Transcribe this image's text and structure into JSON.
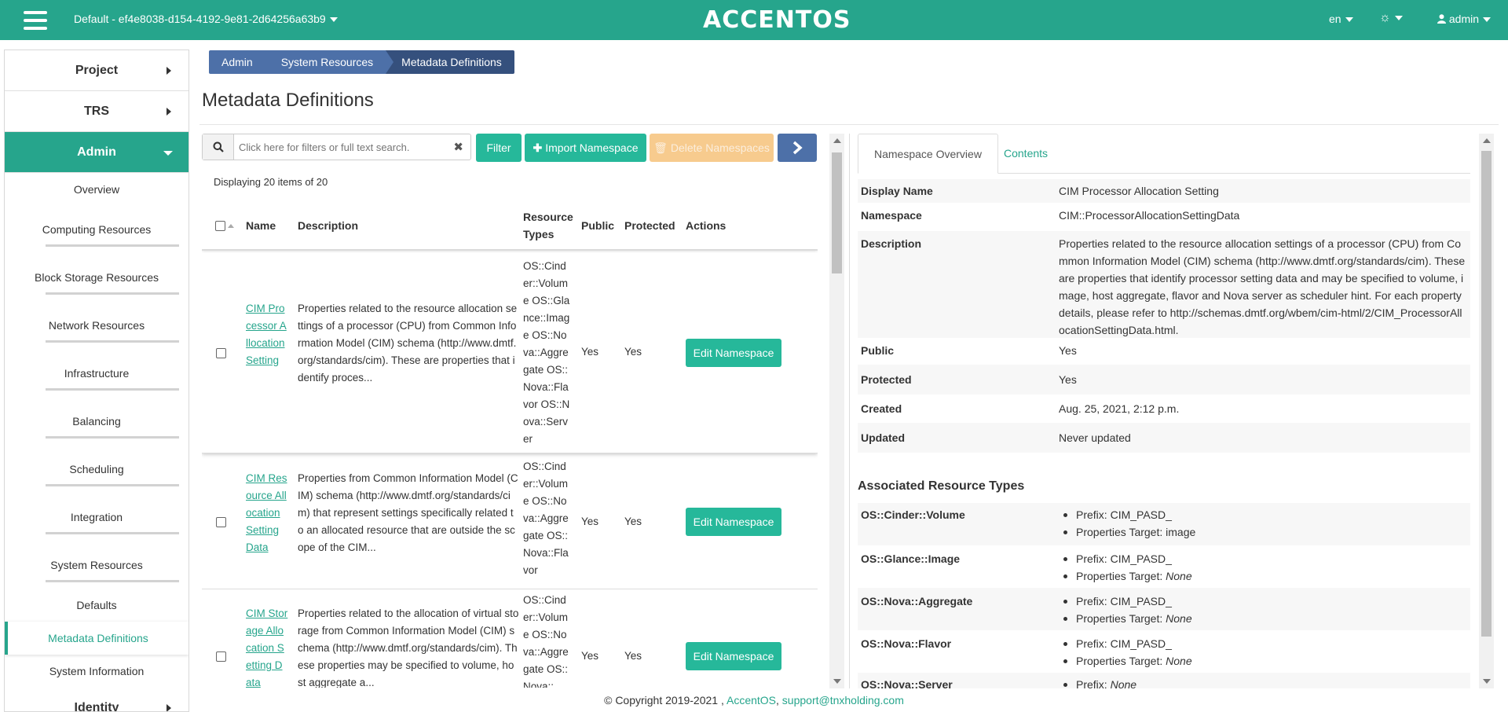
{
  "header": {
    "project_label": "Default - ef4e8038-d154-4192-9e81-2d64256a63b9",
    "logo": "ACCENTOS",
    "language": "en",
    "user": "admin",
    "brand_color": "#26a58c",
    "icons": {
      "menu": "hamburger-icon",
      "theme": "gear-icon",
      "user": "user-icon"
    }
  },
  "sidebar": {
    "sections": [
      "Project",
      "TRS",
      "Admin",
      "Identity"
    ],
    "admin_items": [
      "Overview",
      "Computing Resources",
      "Block Storage Resources",
      "Network Resources",
      "Infrastructure",
      "Balancing",
      "Scheduling",
      "Integration",
      "System Resources"
    ],
    "system_items": [
      "Defaults",
      "Metadata Definitions",
      "System Information"
    ]
  },
  "breadcrumb": [
    "Admin",
    "System Resources",
    "Metadata Definitions"
  ],
  "page_title": "Metadata Definitions",
  "toolbar": {
    "search_placeholder": "Click here for filters or full text search.",
    "filter": "Filter",
    "import": "Import Namespace",
    "delete": "Delete Namespaces"
  },
  "count_text": "Displaying 20 items of 20",
  "table": {
    "headers": {
      "name": "Name",
      "description": "Description",
      "resource_types": "Resource Types",
      "public": "Public",
      "protected": "Protected",
      "actions": "Actions"
    },
    "edit_label": "Edit Namespace",
    "rows": [
      {
        "name": "CIM Processor Allocation Setting",
        "description": "Properties related to the resource allocation settings of a processor (CPU) from Common Information Model (CIM) schema (http://www.dmtf.org/standards/cim). These are properties that identify proces...",
        "resource_types": "OS::Cinder::Volume OS::Glance::Image OS::Nova::Aggregate OS::Nova::Flavor OS::Nova::Server",
        "public": "Yes",
        "protected": "Yes"
      },
      {
        "name": "CIM Resource Allocation Setting Data",
        "description": "Properties from Common Information Model (CIM) schema (http://www.dmtf.org/standards/cim) that represent settings specifically related to an allocated resource that are outside the scope of the CIM...",
        "resource_types": "OS::Cinder::Volume OS::Nova::Aggregate OS::Nova::Flavor",
        "public": "Yes",
        "protected": "Yes"
      },
      {
        "name": "CIM Storage Allocation Setting Data",
        "description": "Properties related to the allocation of virtual storage from Common Information Model (CIM) schema (http://www.dmtf.org/standards/cim). These properties may be specified to volume, host aggregate a...",
        "resource_types": "OS::Cinder::Volume OS::Nova::Aggregate OS::Nova::",
        "public": "Yes",
        "protected": "Yes"
      }
    ]
  },
  "detail": {
    "tabs": [
      "Namespace Overview",
      "Contents"
    ],
    "fields": [
      {
        "label": "Display Name",
        "value": "CIM Processor Allocation Setting"
      },
      {
        "label": "Namespace",
        "value": "CIM::ProcessorAllocationSettingData"
      },
      {
        "label": "Description",
        "value": "Properties related to the resource allocation settings of a processor (CPU) from Common Information Model (CIM) schema (http://www.dmtf.org/standards/cim). These are properties that identify processor setting data and may be specified to volume, image, host aggregate, flavor and Nova server as scheduler hint. For each property details, please refer to http://schemas.dmtf.org/wbem/cim-html/2/CIM_ProcessorAllocationSettingData.html."
      },
      {
        "label": "Public",
        "value": "Yes"
      },
      {
        "label": "Protected",
        "value": "Yes"
      },
      {
        "label": "Created",
        "value": "Aug. 25, 2021, 2:12 p.m."
      },
      {
        "label": "Updated",
        "value": "Never updated"
      }
    ],
    "assoc_title": "Associated Resource Types",
    "prefix_label": "Prefix: ",
    "target_label": "Properties Target: ",
    "assoc": [
      {
        "type": "OS::Cinder::Volume",
        "prefix": "CIM_PASD_",
        "target": "image"
      },
      {
        "type": "OS::Glance::Image",
        "prefix": "CIM_PASD_",
        "target": "None"
      },
      {
        "type": "OS::Nova::Aggregate",
        "prefix": "CIM_PASD_",
        "target": "None"
      },
      {
        "type": "OS::Nova::Flavor",
        "prefix": "CIM_PASD_",
        "target": "None"
      },
      {
        "type": "OS::Nova::Server",
        "prefix": "None"
      }
    ]
  },
  "footer": {
    "copyright": "© Copyright 2019-2021 ,",
    "link1": "AccentOS",
    "sep": ",",
    "link2": "support@tnxholding.com"
  }
}
